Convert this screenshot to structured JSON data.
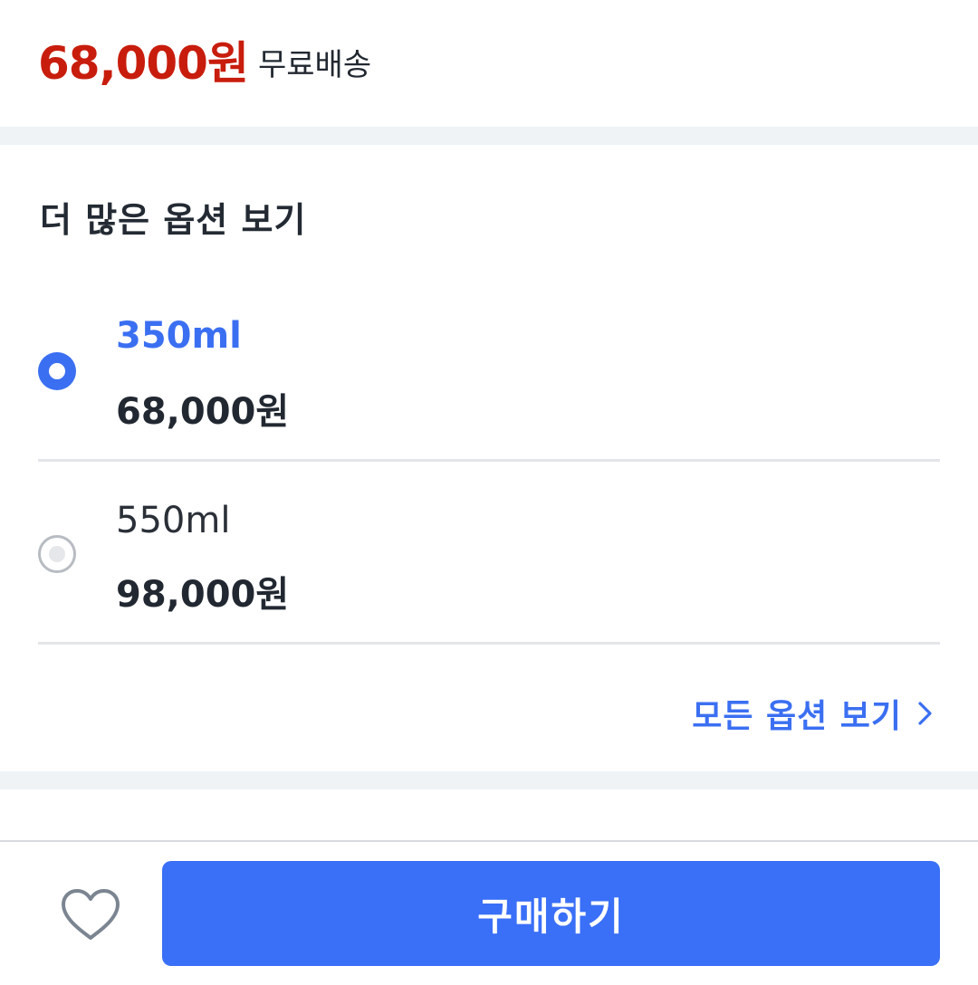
{
  "product": {
    "price": "68,000원",
    "shipping": "무료배송"
  },
  "options": {
    "title": "더 많은 옵션 보기",
    "items": [
      {
        "size": "350ml",
        "price": "68,000원",
        "selected": true
      },
      {
        "size": "550ml",
        "price": "98,000원",
        "selected": false
      }
    ],
    "view_all_label": "모든 옵션 보기"
  },
  "actions": {
    "buy_label": "구매하기"
  },
  "icons": {
    "view_all_chevron": "chevron-right-icon",
    "wishlist": "heart-outline-icon"
  },
  "colors": {
    "price": "#c81d0d",
    "accent": "#3b6ff2",
    "buy_button": "#3a6ff7",
    "band": "#eff3f6"
  }
}
